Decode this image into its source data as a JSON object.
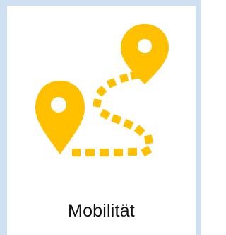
{
  "tile": {
    "label": "Mobilität",
    "icon": "route-map-pins-icon"
  },
  "colors": {
    "accent": "#FFC000",
    "frame": "#CFE0F3",
    "background": "#FFFFFF",
    "text": "#111111"
  }
}
